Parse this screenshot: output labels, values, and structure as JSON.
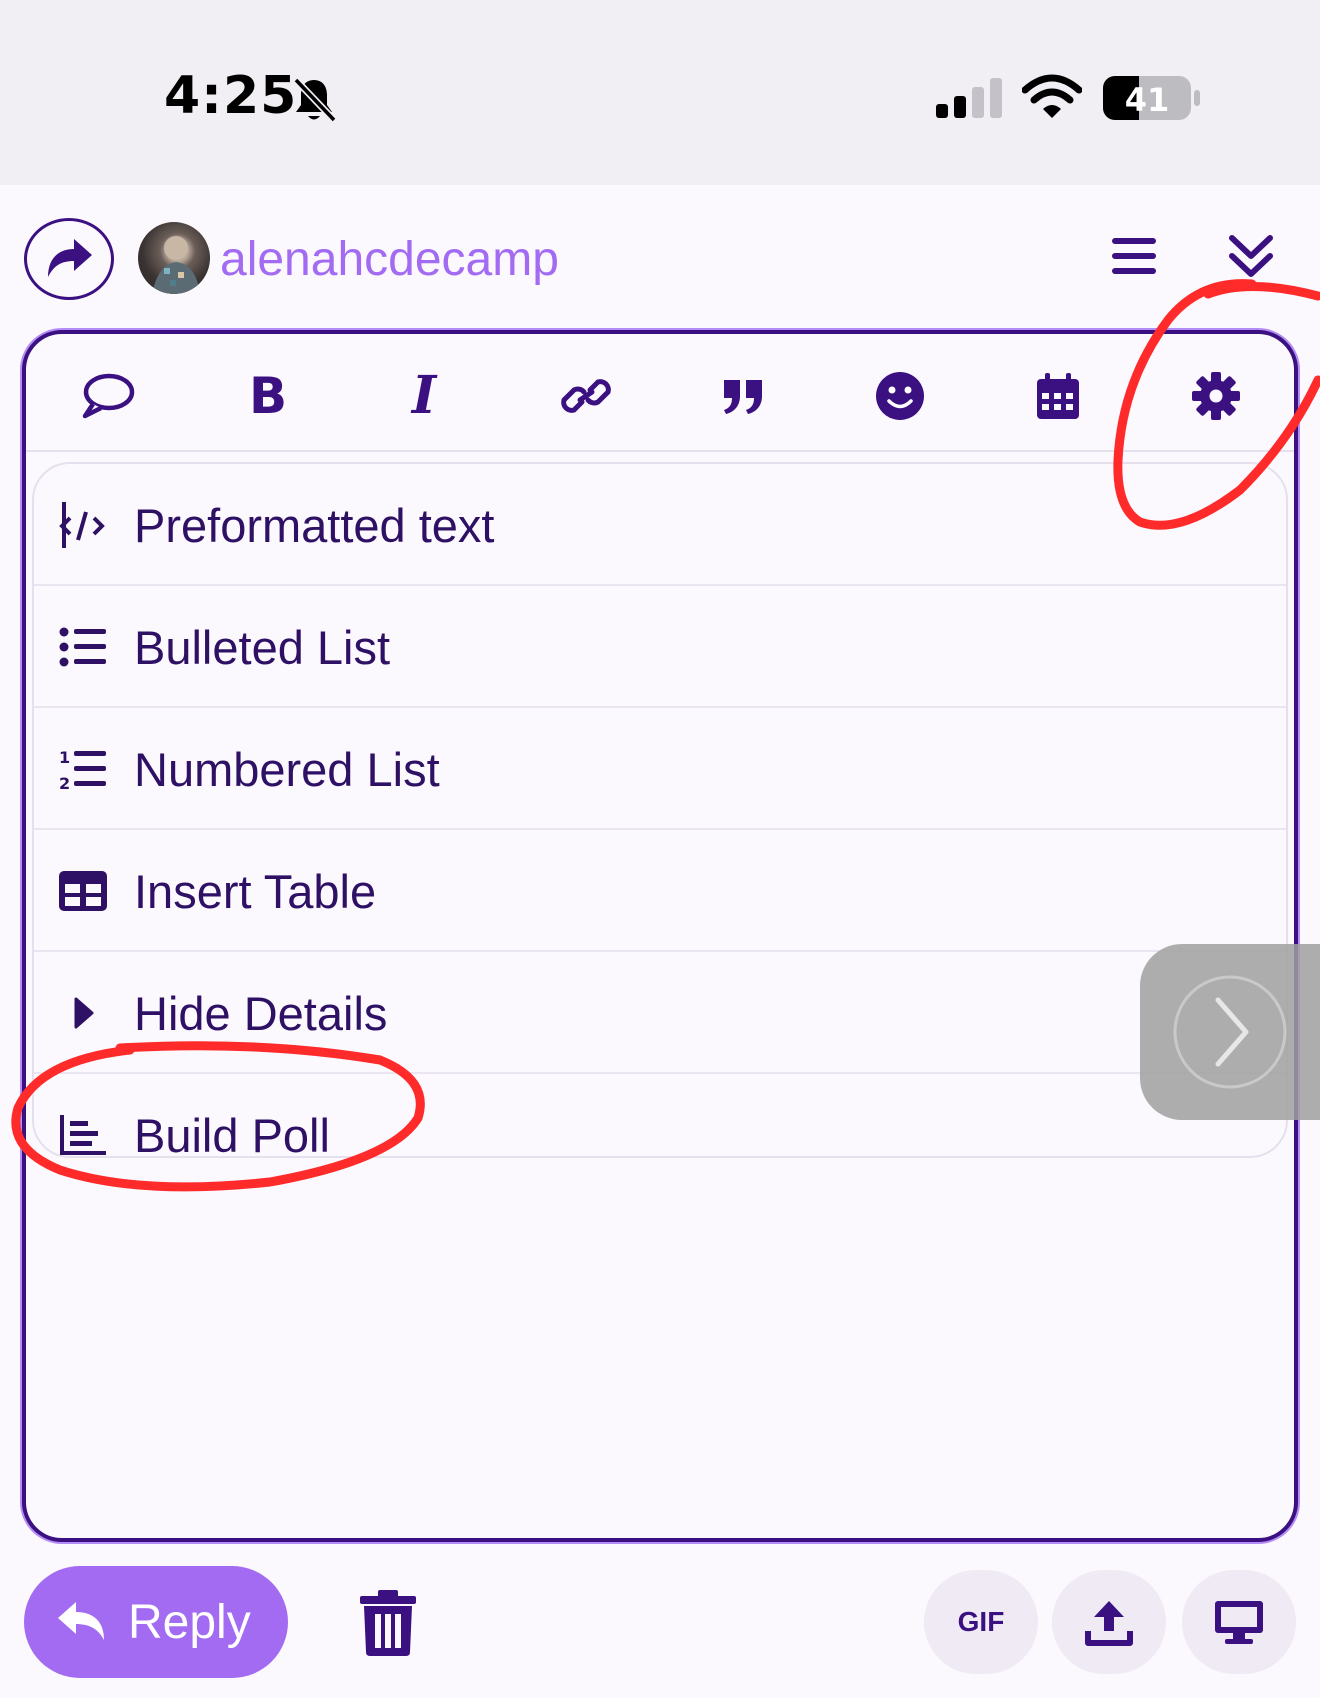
{
  "status_bar": {
    "time": "4:25",
    "battery_level": "41"
  },
  "header": {
    "username": "alenahcdecamp"
  },
  "toolbar": {
    "tools": [
      "chat-bubble-icon",
      "bold-icon",
      "italic-icon",
      "link-icon",
      "quote-icon",
      "emoji-icon",
      "calendar-icon",
      "gear-icon"
    ],
    "bold_glyph": "B",
    "italic_glyph": "I"
  },
  "dropdown": {
    "items": [
      {
        "label": "Preformatted text",
        "icon": "code-icon"
      },
      {
        "label": "Bulleted List",
        "icon": "bulleted-list-icon"
      },
      {
        "label": "Numbered List",
        "icon": "numbered-list-icon"
      },
      {
        "label": "Insert Table",
        "icon": "table-icon"
      },
      {
        "label": "Hide Details",
        "icon": "caret-right-icon"
      },
      {
        "label": "Build Poll",
        "icon": "poll-icon"
      }
    ]
  },
  "footer": {
    "reply_label": "Reply",
    "gif_label": "GIF"
  },
  "colors": {
    "primary": "#3b1182",
    "accent": "#a36bf2",
    "annotation": "#ff2a2a",
    "status_bar_bg": "#f1eef4"
  }
}
